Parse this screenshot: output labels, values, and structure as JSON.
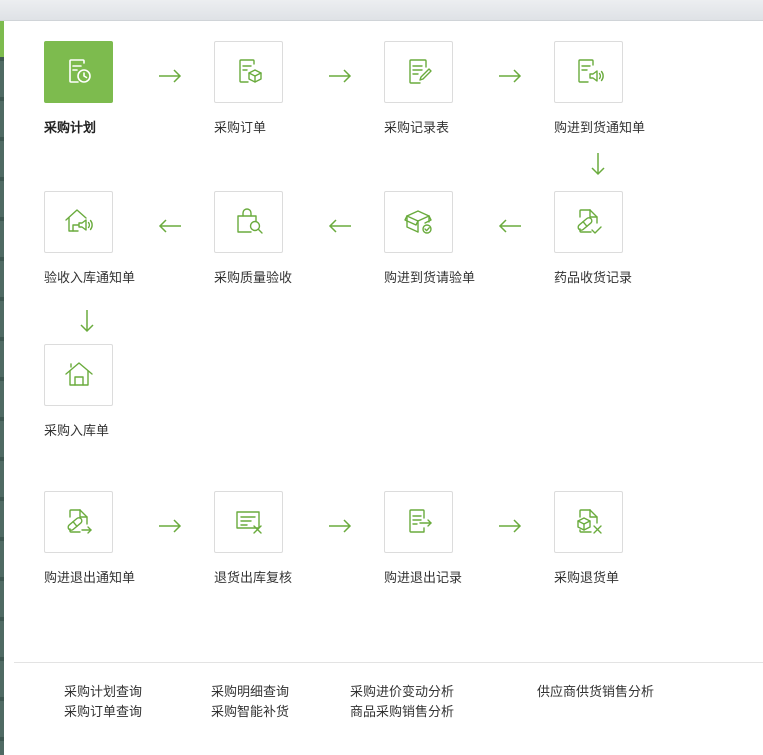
{
  "colors": {
    "accent": "#7dbb4e",
    "icon_stroke": "#6aab3d",
    "border": "#dcdcdc",
    "text": "#333333"
  },
  "flow": {
    "nodes": [
      {
        "label": "采购计划",
        "icon": "plan-clock-icon",
        "active": true
      },
      {
        "label": "采购订单",
        "icon": "order-box-icon"
      },
      {
        "label": "采购记录表",
        "icon": "record-edit-icon"
      },
      {
        "label": "购进到货通知单",
        "icon": "arrival-notice-icon"
      },
      {
        "label": "药品收货记录",
        "icon": "drug-receipt-icon"
      },
      {
        "label": "购进到货请验单",
        "icon": "inspection-box-icon"
      },
      {
        "label": "采购质量验收",
        "icon": "quality-search-icon"
      },
      {
        "label": "验收入库通知单",
        "icon": "warehouse-notice-icon"
      },
      {
        "label": "采购入库单",
        "icon": "warehouse-icon"
      },
      {
        "label": "购进退出通知单",
        "icon": "return-notice-icon"
      },
      {
        "label": "退货出库复核",
        "icon": "return-review-icon"
      },
      {
        "label": "购进退出记录",
        "icon": "return-record-icon"
      },
      {
        "label": "采购退货单",
        "icon": "return-order-icon"
      }
    ]
  },
  "queries": {
    "col1": [
      "采购计划查询",
      "采购订单查询"
    ],
    "col2": [
      "采购明细查询",
      "采购智能补货"
    ],
    "col3": [
      "采购进价变动分析",
      "商品采购销售分析"
    ],
    "col4": [
      "供应商供货销售分析"
    ]
  }
}
